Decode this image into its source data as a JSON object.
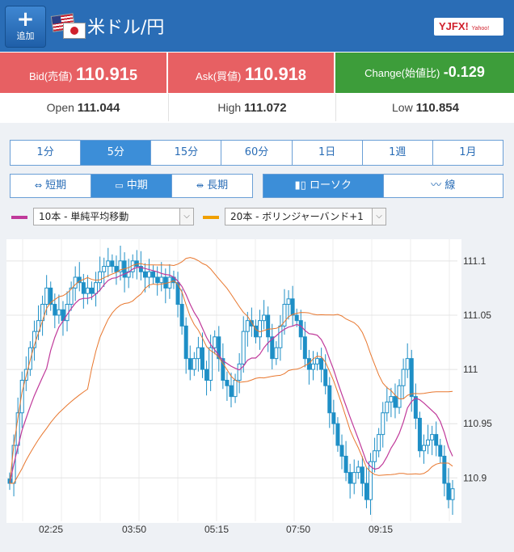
{
  "header": {
    "add_label": "追加",
    "pair_title": "米ドル/円",
    "logo_text": "YJFX!",
    "logo_small": "Yahoo!"
  },
  "prices": {
    "bid_label": "Bid(売値)",
    "bid_main": "110.91",
    "bid_tail": "5",
    "ask_label": "Ask(買値)",
    "ask_main": "110.91",
    "ask_tail": "8",
    "change_label": "Change(始値比)",
    "change_value": "-0.129",
    "open_label": "Open",
    "open_value": "111.044",
    "high_label": "High",
    "high_value": "111.072",
    "low_label": "Low",
    "low_value": "110.854"
  },
  "timeframes": [
    "1分",
    "5分",
    "15分",
    "60分",
    "1日",
    "1週",
    "1月"
  ],
  "timeframe_selected": 1,
  "terms": [
    "短期",
    "中期",
    "長期"
  ],
  "term_selected": 1,
  "chart_types": [
    "ローソク",
    "線"
  ],
  "chart_type_selected": 0,
  "indicators": [
    {
      "label": "10本 - 単純平均移動",
      "color": "#c0399a"
    },
    {
      "label": "20本 - ボリンジャーバンド+1",
      "color": "#f0a000"
    }
  ],
  "colors": {
    "header": "#2a6db6",
    "bid_bg": "#e76063",
    "change_bg": "#3d9d3a",
    "candle": "#1e8fc6",
    "ma": "#c0399a",
    "bb": "#e8772e"
  },
  "chart_data": {
    "type": "candlestick",
    "y_ticks": [
      "111.1",
      "111.05",
      "111",
      "110.95",
      "110.9"
    ],
    "x_ticks": [
      "02:25",
      "03:50",
      "05:15",
      "07:50",
      "09:15"
    ],
    "ylim": [
      110.86,
      111.12
    ],
    "grid": true,
    "close": [
      110.895,
      110.93,
      110.96,
      110.99,
      111.0,
      111.02,
      111.035,
      111.045,
      111.06,
      111.075,
      111.06,
      111.05,
      111.055,
      111.045,
      111.06,
      111.075,
      111.085,
      111.08,
      111.07,
      111.075,
      111.07,
      111.08,
      111.09,
      111.095,
      111.1,
      111.095,
      111.09,
      111.1,
      111.085,
      111.09,
      111.1,
      111.095,
      111.09,
      111.085,
      111.09,
      111.085,
      111.08,
      111.085,
      111.075,
      111.085,
      111.08,
      111.06,
      111.04,
      111.01,
      111.0,
      111.01,
      111.02,
      111.0,
      110.99,
      111.02,
      111.03,
      111.01,
      110.99,
      110.985,
      110.975,
      110.99,
      111.005,
      111.035,
      111.045,
      111.04,
      111.03,
      111.045,
      111.05,
      111.03,
      111.01,
      111.02,
      111.04,
      111.06,
      111.065,
      111.05,
      111.045,
      111.03,
      111.01,
      111.0,
      111.005,
      111.01,
      111.0,
      110.985,
      110.96,
      110.95,
      110.93,
      110.92,
      110.905,
      110.895,
      110.905,
      110.91,
      110.895,
      110.88,
      110.915,
      110.925,
      110.94,
      110.96,
      110.97,
      110.975,
      110.965,
      110.985,
      111.0,
      111.01,
      110.975,
      110.955,
      110.925,
      110.93,
      110.935,
      110.94,
      110.93,
      110.92,
      110.895,
      110.88,
      110.89
    ]
  }
}
